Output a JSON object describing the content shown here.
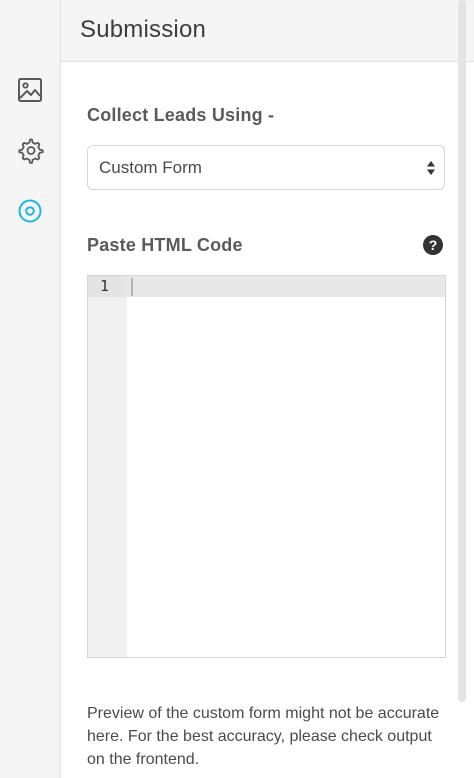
{
  "header": {
    "title": "Submission"
  },
  "rail": {
    "items": [
      {
        "icon": "image-icon",
        "active": false
      },
      {
        "icon": "gear-icon",
        "active": false
      },
      {
        "icon": "target-icon",
        "active": true
      }
    ],
    "active_color": "#1fb5e8",
    "inactive_color": "#5a5a5a"
  },
  "collect": {
    "label": "Collect Leads Using -",
    "selected": "Custom Form"
  },
  "html_code": {
    "label": "Paste HTML Code",
    "help_glyph": "?",
    "line_numbers": [
      "1"
    ]
  },
  "note": "Preview of the custom form might not be accurate here. For the best accuracy, please check output on the frontend."
}
